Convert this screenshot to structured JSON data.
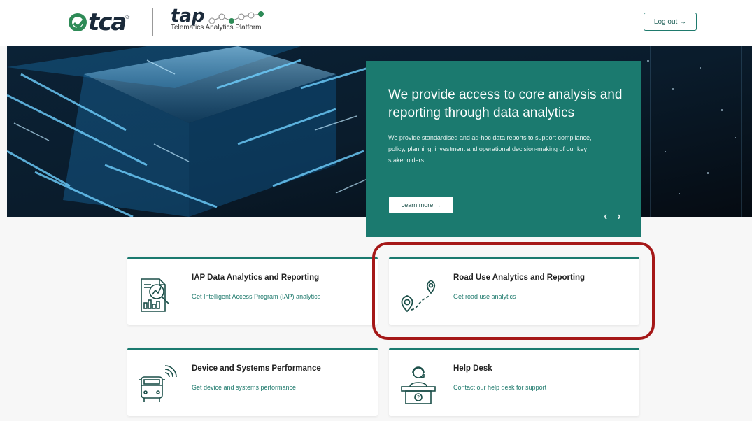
{
  "header": {
    "logo_tca_text": "tca",
    "logo_tca_mark": "®",
    "logo_tap_text": "tap",
    "logo_tap_subtitle": "Telematics Analytics Platform",
    "logout_label": "Log out →"
  },
  "hero": {
    "title": "We provide access to core analysis and reporting through data analytics",
    "body": "We provide standardised and ad-hoc data reports to support compliance, policy, planning, investment and operational decision-making of our key stakeholders.",
    "learn_more_label": "Learn more →",
    "prev_label": "‹",
    "next_label": "›"
  },
  "cards": {
    "iap": {
      "title": "IAP Data Analytics and Reporting",
      "desc": "Get Intelligent Access Program (IAP) analytics",
      "icon": "report-magnifier-icon"
    },
    "road": {
      "title": "Road Use Analytics and Reporting",
      "desc": "Get road use analytics",
      "icon": "map-route-icon"
    },
    "device": {
      "title": "Device and Systems Performance",
      "desc": "Get device and systems performance",
      "icon": "connected-bus-icon"
    },
    "help": {
      "title": "Help Desk",
      "desc": "Contact our help desk for support",
      "icon": "help-desk-agent-icon"
    }
  },
  "colors": {
    "accent": "#1b7a6f",
    "highlight": "#a51818"
  }
}
